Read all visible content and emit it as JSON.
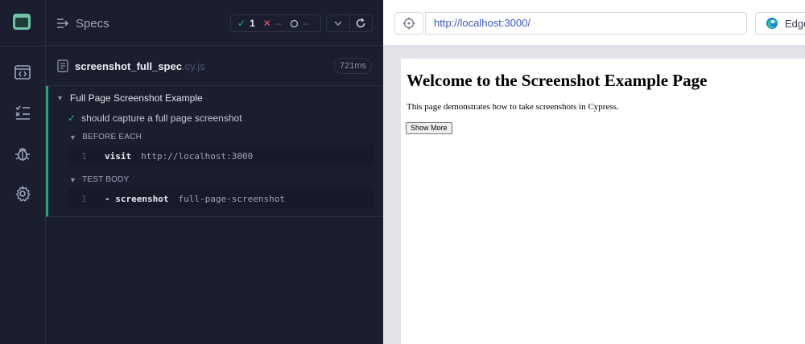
{
  "sidebar": {
    "items": [
      {
        "icon": "app-logo-icon"
      },
      {
        "icon": "code-window-icon"
      },
      {
        "icon": "run-list-icon"
      },
      {
        "icon": "bug-icon"
      },
      {
        "icon": "gear-icon"
      }
    ]
  },
  "reporter": {
    "specs_label": "Specs",
    "stats": {
      "passed": "1",
      "failed": "--",
      "pending": "--"
    },
    "spec": {
      "name": "screenshot_full_spec",
      "ext": ".cy.js",
      "duration": "721ms"
    },
    "suite": {
      "title": "Full Page Screenshot Example",
      "test": "should capture a full page screenshot",
      "hooks": [
        {
          "label": "BEFORE EACH",
          "commands": [
            {
              "index": "1",
              "name": "visit",
              "arg": "http://localhost:3000"
            }
          ]
        },
        {
          "label": "TEST BODY",
          "commands": [
            {
              "index": "1",
              "name": "- screenshot",
              "arg": "full-page-screenshot"
            }
          ]
        }
      ]
    }
  },
  "browser": {
    "url": "http://localhost:3000/",
    "name": "Edge",
    "page": {
      "heading": "Welcome to the Screenshot Example Page",
      "paragraph": "This page demonstrates how to take screenshots in Cypress.",
      "button": "Show More"
    }
  },
  "colors": {
    "background": "#1b1e2e",
    "accent_green": "#1fb97a",
    "fail_red": "#e45770",
    "url_blue": "#3a57c5"
  }
}
